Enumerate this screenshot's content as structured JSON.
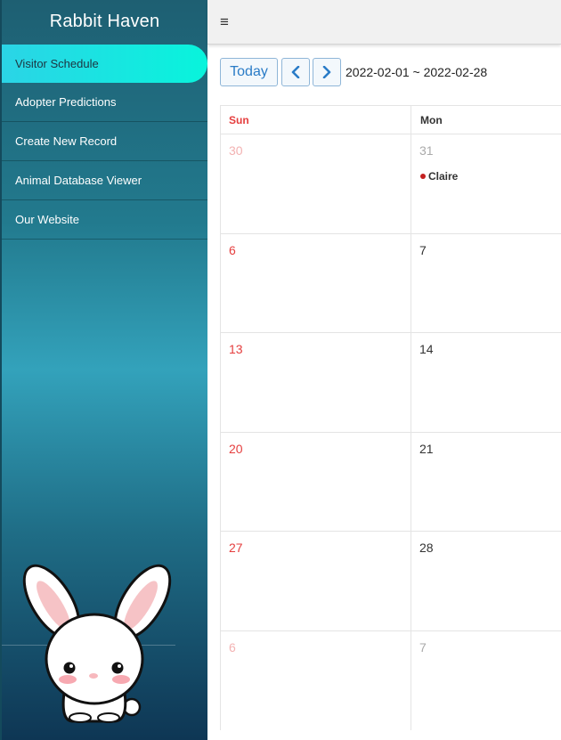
{
  "sidebar": {
    "brand": "Rabbit Haven",
    "items": [
      {
        "label": "Visitor Schedule"
      },
      {
        "label": "Adopter Predictions"
      },
      {
        "label": "Create New Record"
      },
      {
        "label": "Animal Database Viewer"
      },
      {
        "label": "Our Website"
      }
    ],
    "active_index": 0
  },
  "topbar": {
    "menu_icon": "hamburger-icon",
    "menu_glyph": "≡"
  },
  "toolbar": {
    "today_label": "Today",
    "prev_icon": "chevron-left-icon",
    "next_icon": "chevron-right-icon",
    "range": "2022-02-01 ~ 2022-02-28"
  },
  "calendar": {
    "headers": [
      "Sun",
      "Mon"
    ],
    "weeks": [
      {
        "sun": "30",
        "mon": "31",
        "sun_muted": true,
        "mon_muted": true,
        "mon_event": "Claire"
      },
      {
        "sun": "6",
        "mon": "7"
      },
      {
        "sun": "13",
        "mon": "14"
      },
      {
        "sun": "20",
        "mon": "21"
      },
      {
        "sun": "27",
        "mon": "28"
      },
      {
        "sun": "6",
        "mon": "7",
        "sun_muted": true,
        "mon_muted": true
      }
    ],
    "colors": {
      "sunday": "#e53e3e",
      "event_dot": "#c42020",
      "accent": "#2a7cc7"
    }
  }
}
